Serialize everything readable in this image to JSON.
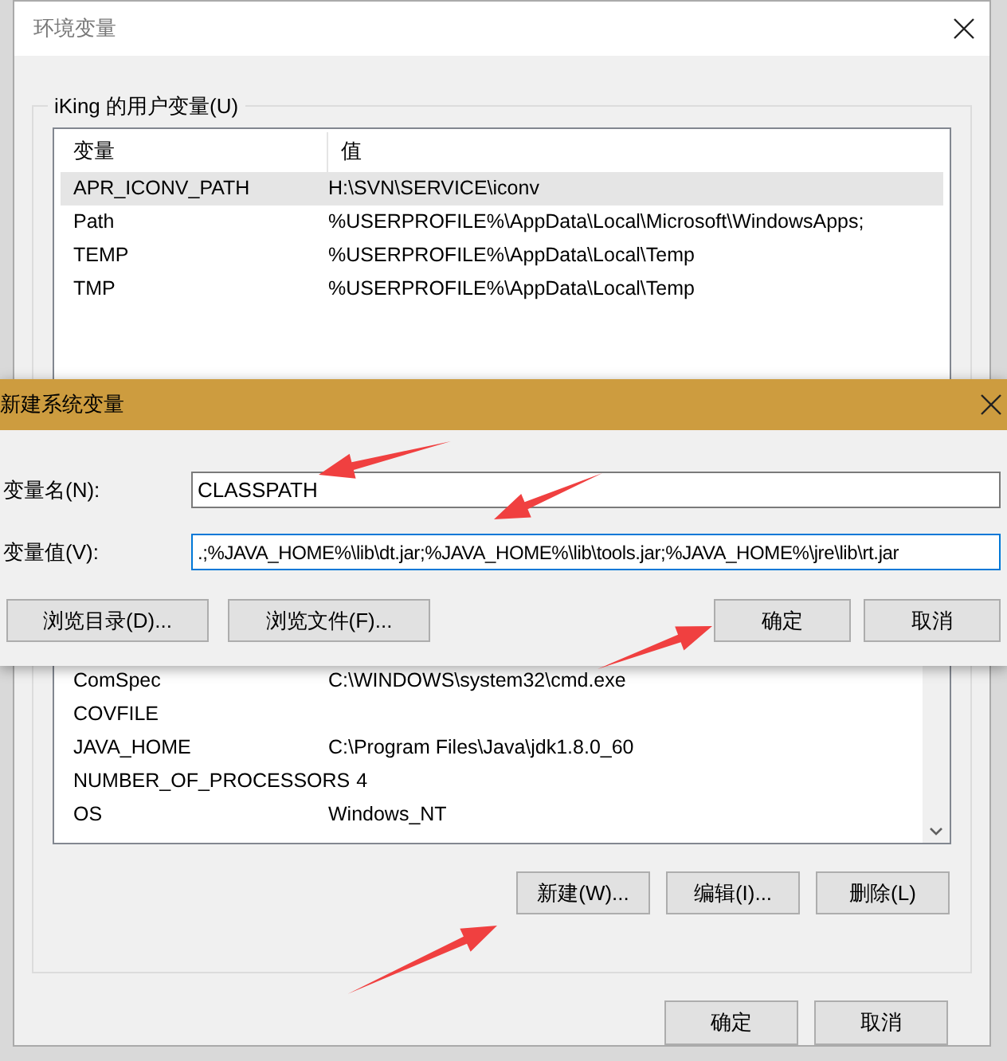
{
  "window": {
    "title": "环境变量"
  },
  "user_variables": {
    "label": "iKing 的用户变量(U)",
    "columns": [
      "变量",
      "值"
    ],
    "rows": [
      {
        "name": "APR_ICONV_PATH",
        "value": "H:\\SVN\\SERVICE\\iconv",
        "selected": true
      },
      {
        "name": "Path",
        "value": "%USERPROFILE%\\AppData\\Local\\Microsoft\\WindowsApps;",
        "selected": false
      },
      {
        "name": "TEMP",
        "value": "%USERPROFILE%\\AppData\\Local\\Temp",
        "selected": false
      },
      {
        "name": "TMP",
        "value": "%USERPROFILE%\\AppData\\Local\\Temp",
        "selected": false
      }
    ]
  },
  "system_variables": {
    "rows": [
      {
        "name": "ComSpec",
        "value": "C:\\WINDOWS\\system32\\cmd.exe",
        "selected": false
      },
      {
        "name": "COVFILE",
        "value": "",
        "selected": false
      },
      {
        "name": "JAVA_HOME",
        "value": "C:\\Program Files\\Java\\jdk1.8.0_60",
        "selected": false
      },
      {
        "name": "NUMBER_OF_PROCESSORS",
        "value": "4",
        "selected": false
      },
      {
        "name": "OS",
        "value": "Windows_NT",
        "selected": false
      }
    ],
    "buttons": [
      "新建(W)...",
      "编辑(I)...",
      "删除(L)"
    ]
  },
  "window_buttons": [
    "确定",
    "取消"
  ],
  "dialog": {
    "title": "新建系统变量",
    "fields": [
      {
        "label": "变量名(N):",
        "value": "CLASSPATH",
        "focused": false
      },
      {
        "label": "变量值(V):",
        "value": ".;%JAVA_HOME%\\lib\\dt.jar;%JAVA_HOME%\\lib\\tools.jar;%JAVA_HOME%\\jre\\lib\\rt.jar",
        "focused": true
      }
    ],
    "browse_buttons": [
      "浏览目录(D)...",
      "浏览文件(F)..."
    ],
    "buttons": [
      "确定",
      "取消"
    ]
  }
}
